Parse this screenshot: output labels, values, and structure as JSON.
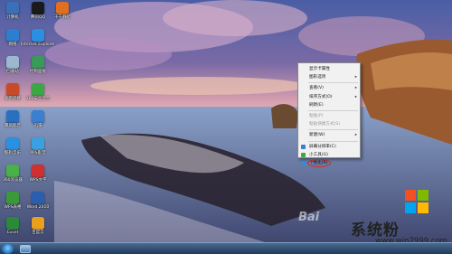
{
  "desktop_icons": [
    {
      "label": "计算机",
      "icon": "computer-icon",
      "color": "#3b6fb8"
    },
    {
      "label": "腾讯QQ",
      "icon": "qq-icon",
      "color": "#1a1a1a"
    },
    {
      "label": "网络",
      "icon": "network-icon",
      "color": "#2c7fcf"
    },
    {
      "label": "Internet Explorer",
      "icon": "ie-icon",
      "color": "#2a8fe0"
    },
    {
      "label": "回收站",
      "icon": "recycle-bin-icon",
      "color": "#9bb8d0"
    },
    {
      "label": "控制面板",
      "icon": "control-panel-icon",
      "color": "#3a9a5a"
    },
    {
      "label": "宽带连接",
      "icon": "broadband-icon",
      "color": "#c84a2a"
    },
    {
      "label": "360安全卫士",
      "icon": "shield-icon",
      "color": "#3aa845"
    },
    {
      "label": "暴风影音",
      "icon": "player-icon",
      "color": "#2a6fc0"
    },
    {
      "label": "迅雷",
      "icon": "thunder-icon",
      "color": "#3a7fd0"
    },
    {
      "label": "酷狗音乐",
      "icon": "music-icon",
      "color": "#2a90e0"
    },
    {
      "label": "PPS影音",
      "icon": "video-icon",
      "color": "#3aa0e0"
    },
    {
      "label": "360浏览器",
      "icon": "browser-icon",
      "color": "#4ab04a"
    },
    {
      "label": "WPS文字",
      "icon": "document-icon",
      "color": "#d03030"
    },
    {
      "label": "WPS表格",
      "icon": "spreadsheet-icon",
      "color": "#3a9a3a"
    },
    {
      "label": "Word 2010",
      "icon": "word-icon",
      "color": "#2a5fb0"
    },
    {
      "label": "Excel",
      "icon": "excel-icon",
      "color": "#2a8a3a"
    },
    {
      "label": "百度云",
      "icon": "cloud-icon",
      "color": "#e8a020"
    },
    {
      "label": "千千静听",
      "icon": "media-icon",
      "color": "#e07020"
    }
  ],
  "context_menu": {
    "items": [
      {
        "label": "显示卡属性",
        "disabled": false,
        "arrow": false,
        "icon_color": ""
      },
      {
        "label": "图形选项",
        "disabled": false,
        "arrow": true,
        "icon_color": ""
      },
      {
        "separator": true
      },
      {
        "label": "查看(V)",
        "disabled": false,
        "arrow": true,
        "icon_color": ""
      },
      {
        "label": "排序方式(O)",
        "disabled": false,
        "arrow": true,
        "icon_color": ""
      },
      {
        "label": "刷新(E)",
        "disabled": false,
        "arrow": false,
        "icon_color": ""
      },
      {
        "separator": true
      },
      {
        "label": "粘贴(P)",
        "disabled": true,
        "arrow": false,
        "icon_color": ""
      },
      {
        "label": "粘贴快捷方式(S)",
        "disabled": true,
        "arrow": false,
        "icon_color": ""
      },
      {
        "separator": true
      },
      {
        "label": "新建(W)",
        "disabled": false,
        "arrow": true,
        "icon_color": ""
      },
      {
        "separator": true
      },
      {
        "label": "屏幕分辨率(C)",
        "disabled": false,
        "arrow": false,
        "icon_color": "#3a7fd0"
      },
      {
        "label": "小工具(G)",
        "disabled": false,
        "arrow": false,
        "icon_color": "#3aa845"
      },
      {
        "label": "个性化(R)",
        "disabled": false,
        "arrow": false,
        "icon_color": "#2a8fe0",
        "highlighted": true
      }
    ],
    "highlight_color": "#e02020"
  },
  "watermark": {
    "brand": "系统粉",
    "url": "www.win7999.com",
    "baidu": "Bai"
  },
  "taskbar": {
    "start_label": "",
    "app_icon": "explorer-icon"
  }
}
